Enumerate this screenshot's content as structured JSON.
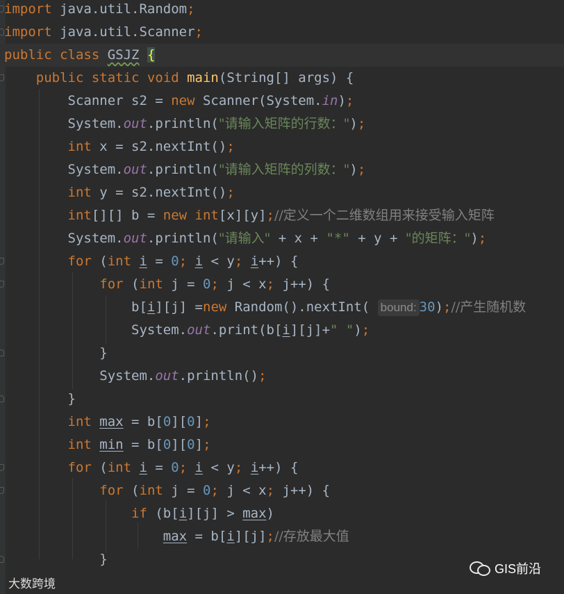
{
  "editor": {
    "lines": [
      {
        "tokens": [
          {
            "t": "import",
            "c": "kw"
          },
          {
            "t": " java.util.Random"
          },
          {
            "t": ";",
            "c": "kw"
          }
        ]
      },
      {
        "tokens": [
          {
            "t": "import",
            "c": "kw"
          },
          {
            "t": " java.util.Scanner"
          },
          {
            "t": ";",
            "c": "kw"
          }
        ]
      },
      {
        "hl": true,
        "tokens": [
          {
            "t": "public class ",
            "c": "kw"
          },
          {
            "t": "GSJZ",
            "c": "wavy"
          },
          {
            "t": " "
          },
          {
            "t": "{",
            "c": "brc"
          }
        ]
      },
      {
        "tokens": [
          {
            "t": "    "
          },
          {
            "t": "public static void ",
            "c": "kw"
          },
          {
            "t": "main",
            "c": "fn"
          },
          {
            "t": "(String[] args) {"
          }
        ]
      },
      {
        "tokens": [
          {
            "t": "        Scanner s2 = "
          },
          {
            "t": "new ",
            "c": "kw"
          },
          {
            "t": "Scanner(System."
          },
          {
            "t": "in",
            "c": "fld"
          },
          {
            "t": ")"
          },
          {
            "t": ";",
            "c": "kw"
          }
        ]
      },
      {
        "tokens": [
          {
            "t": "        System."
          },
          {
            "t": "out",
            "c": "fld"
          },
          {
            "t": ".println("
          },
          {
            "t": "\"请输入矩阵的行数：\"",
            "c": "st"
          },
          {
            "t": ")"
          },
          {
            "t": ";",
            "c": "kw"
          }
        ]
      },
      {
        "tokens": [
          {
            "t": "        "
          },
          {
            "t": "int ",
            "c": "kw"
          },
          {
            "t": "x = s2.nextInt()"
          },
          {
            "t": ";",
            "c": "kw"
          }
        ]
      },
      {
        "tokens": [
          {
            "t": "        System."
          },
          {
            "t": "out",
            "c": "fld"
          },
          {
            "t": ".println("
          },
          {
            "t": "\"请输入矩阵的列数：\"",
            "c": "st"
          },
          {
            "t": ")"
          },
          {
            "t": ";",
            "c": "kw"
          }
        ]
      },
      {
        "tokens": [
          {
            "t": "        "
          },
          {
            "t": "int ",
            "c": "kw"
          },
          {
            "t": "y = s2.nextInt()"
          },
          {
            "t": ";",
            "c": "kw"
          }
        ]
      },
      {
        "tokens": [
          {
            "t": "        "
          },
          {
            "t": "int",
            "c": "kw"
          },
          {
            "t": "[][] b = "
          },
          {
            "t": "new int",
            "c": "kw"
          },
          {
            "t": "[x][y]"
          },
          {
            "t": ";",
            "c": "kw"
          },
          {
            "t": "//定义一个二维数组用来接受输入矩阵",
            "c": "cm"
          }
        ]
      },
      {
        "tokens": [
          {
            "t": "        System."
          },
          {
            "t": "out",
            "c": "fld"
          },
          {
            "t": ".println("
          },
          {
            "t": "\"请输入\"",
            "c": "st"
          },
          {
            "t": " + x + "
          },
          {
            "t": "\"*\"",
            "c": "st"
          },
          {
            "t": " + y + "
          },
          {
            "t": "\"的矩阵：\"",
            "c": "st"
          },
          {
            "t": ")"
          },
          {
            "t": ";",
            "c": "kw"
          }
        ]
      },
      {
        "tokens": [
          {
            "t": "        "
          },
          {
            "t": "for ",
            "c": "kw"
          },
          {
            "t": "("
          },
          {
            "t": "int ",
            "c": "kw"
          },
          {
            "t": "i",
            "c": "ul"
          },
          {
            "t": " = "
          },
          {
            "t": "0",
            "c": "num"
          },
          {
            "t": "; ",
            "c": "kw"
          },
          {
            "t": "i",
            "c": "ul"
          },
          {
            "t": " < y"
          },
          {
            "t": "; ",
            "c": "kw"
          },
          {
            "t": "i",
            "c": "ul"
          },
          {
            "t": "++) {"
          }
        ]
      },
      {
        "tokens": [
          {
            "t": "            "
          },
          {
            "t": "for ",
            "c": "kw"
          },
          {
            "t": "("
          },
          {
            "t": "int ",
            "c": "kw"
          },
          {
            "t": "j = "
          },
          {
            "t": "0",
            "c": "num"
          },
          {
            "t": "; ",
            "c": "kw"
          },
          {
            "t": "j < x"
          },
          {
            "t": "; ",
            "c": "kw"
          },
          {
            "t": "j++) {"
          }
        ]
      },
      {
        "tokens": [
          {
            "t": "                b["
          },
          {
            "t": "i",
            "c": "ul"
          },
          {
            "t": "][j] ="
          },
          {
            "t": "new ",
            "c": "kw"
          },
          {
            "t": "Random().nextInt( "
          },
          {
            "t": "bound:",
            "c": "hint"
          },
          {
            "t": "30",
            "c": "num"
          },
          {
            "t": ")"
          },
          {
            "t": ";",
            "c": "kw"
          },
          {
            "t": "//产生随机数",
            "c": "cm"
          }
        ]
      },
      {
        "tokens": [
          {
            "t": "                System."
          },
          {
            "t": "out",
            "c": "fld"
          },
          {
            "t": ".print(b["
          },
          {
            "t": "i",
            "c": "ul"
          },
          {
            "t": "][j]+"
          },
          {
            "t": "\" \"",
            "c": "st"
          },
          {
            "t": ")"
          },
          {
            "t": ";",
            "c": "kw"
          }
        ]
      },
      {
        "tokens": [
          {
            "t": "            }"
          }
        ]
      },
      {
        "tokens": [
          {
            "t": "            System."
          },
          {
            "t": "out",
            "c": "fld"
          },
          {
            "t": ".println()"
          },
          {
            "t": ";",
            "c": "kw"
          }
        ]
      },
      {
        "tokens": [
          {
            "t": "        }"
          }
        ]
      },
      {
        "tokens": [
          {
            "t": "        "
          },
          {
            "t": "int ",
            "c": "kw"
          },
          {
            "t": "max",
            "c": "ul"
          },
          {
            "t": " = b["
          },
          {
            "t": "0",
            "c": "num"
          },
          {
            "t": "]["
          },
          {
            "t": "0",
            "c": "num"
          },
          {
            "t": "]"
          },
          {
            "t": ";",
            "c": "kw"
          }
        ]
      },
      {
        "tokens": [
          {
            "t": "        "
          },
          {
            "t": "int ",
            "c": "kw"
          },
          {
            "t": "min",
            "c": "ul"
          },
          {
            "t": " = b["
          },
          {
            "t": "0",
            "c": "num"
          },
          {
            "t": "]["
          },
          {
            "t": "0",
            "c": "num"
          },
          {
            "t": "]"
          },
          {
            "t": ";",
            "c": "kw"
          }
        ]
      },
      {
        "tokens": [
          {
            "t": "        "
          },
          {
            "t": "for ",
            "c": "kw"
          },
          {
            "t": "("
          },
          {
            "t": "int ",
            "c": "kw"
          },
          {
            "t": "i",
            "c": "ul"
          },
          {
            "t": " = "
          },
          {
            "t": "0",
            "c": "num"
          },
          {
            "t": "; ",
            "c": "kw"
          },
          {
            "t": "i",
            "c": "ul"
          },
          {
            "t": " < y"
          },
          {
            "t": "; ",
            "c": "kw"
          },
          {
            "t": "i",
            "c": "ul"
          },
          {
            "t": "++) {"
          }
        ]
      },
      {
        "tokens": [
          {
            "t": "            "
          },
          {
            "t": "for ",
            "c": "kw"
          },
          {
            "t": "("
          },
          {
            "t": "int ",
            "c": "kw"
          },
          {
            "t": "j = "
          },
          {
            "t": "0",
            "c": "num"
          },
          {
            "t": "; ",
            "c": "kw"
          },
          {
            "t": "j < x"
          },
          {
            "t": "; ",
            "c": "kw"
          },
          {
            "t": "j++) {"
          }
        ]
      },
      {
        "tokens": [
          {
            "t": "                "
          },
          {
            "t": "if ",
            "c": "kw"
          },
          {
            "t": "(b["
          },
          {
            "t": "i",
            "c": "ul"
          },
          {
            "t": "][j] > "
          },
          {
            "t": "max",
            "c": "ul"
          },
          {
            "t": ")"
          }
        ]
      },
      {
        "tokens": [
          {
            "t": "                    "
          },
          {
            "t": "max",
            "c": "ul"
          },
          {
            "t": " = b["
          },
          {
            "t": "i",
            "c": "ul"
          },
          {
            "t": "][j]"
          },
          {
            "t": ";",
            "c": "kw"
          },
          {
            "t": "//存放最大值",
            "c": "cm"
          }
        ]
      },
      {
        "tokens": [
          {
            "t": "            }"
          }
        ]
      }
    ]
  },
  "watermarks": {
    "left": "大数跨境",
    "right": "GIS前沿"
  }
}
